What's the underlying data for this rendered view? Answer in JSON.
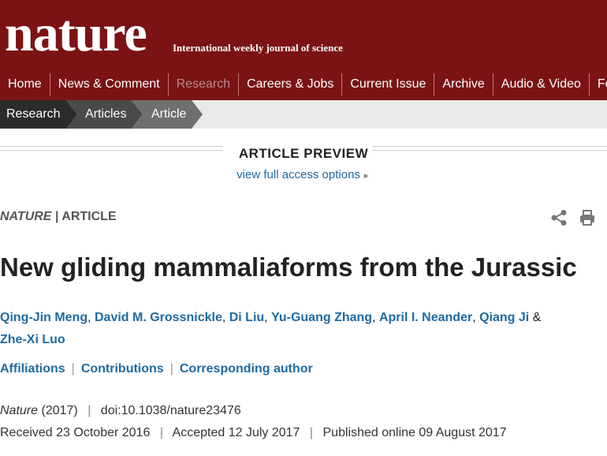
{
  "header": {
    "logo": "nature",
    "tagline": "International weekly journal of science",
    "nav": [
      "Home",
      "News & Comment",
      "Research",
      "Careers & Jobs",
      "Current Issue",
      "Archive",
      "Audio & Video",
      "For"
    ],
    "active_nav": "Research",
    "brand_color": "#7b1315"
  },
  "breadcrumb": [
    "Research",
    "Articles",
    "Article"
  ],
  "preview": {
    "title": "ARTICLE PREVIEW",
    "link": "view full access options"
  },
  "meta": {
    "journal": "NATURE",
    "separator": "|",
    "type": "ARTICLE"
  },
  "tools": {
    "share": "share-icon",
    "print": "print-icon"
  },
  "article": {
    "title": "New gliding mammaliaforms from the Jurassic",
    "authors": [
      "Qing-Jin Meng",
      "David M. Grossnickle",
      "Di Liu",
      "Yu-Guang Zhang",
      "April I. Neander",
      "Qiang Ji",
      "Zhe-Xi Luo"
    ],
    "links": [
      "Affiliations",
      "Contributions",
      "Corresponding author"
    ],
    "journal": "Nature",
    "year": "(2017)",
    "doi": "doi:10.1038/nature23476",
    "received_label": "Received",
    "received": "23 October 2016",
    "accepted_label": "Accepted",
    "accepted": "12 July 2017",
    "published_label": "Published online",
    "published": "09 August 2017"
  }
}
